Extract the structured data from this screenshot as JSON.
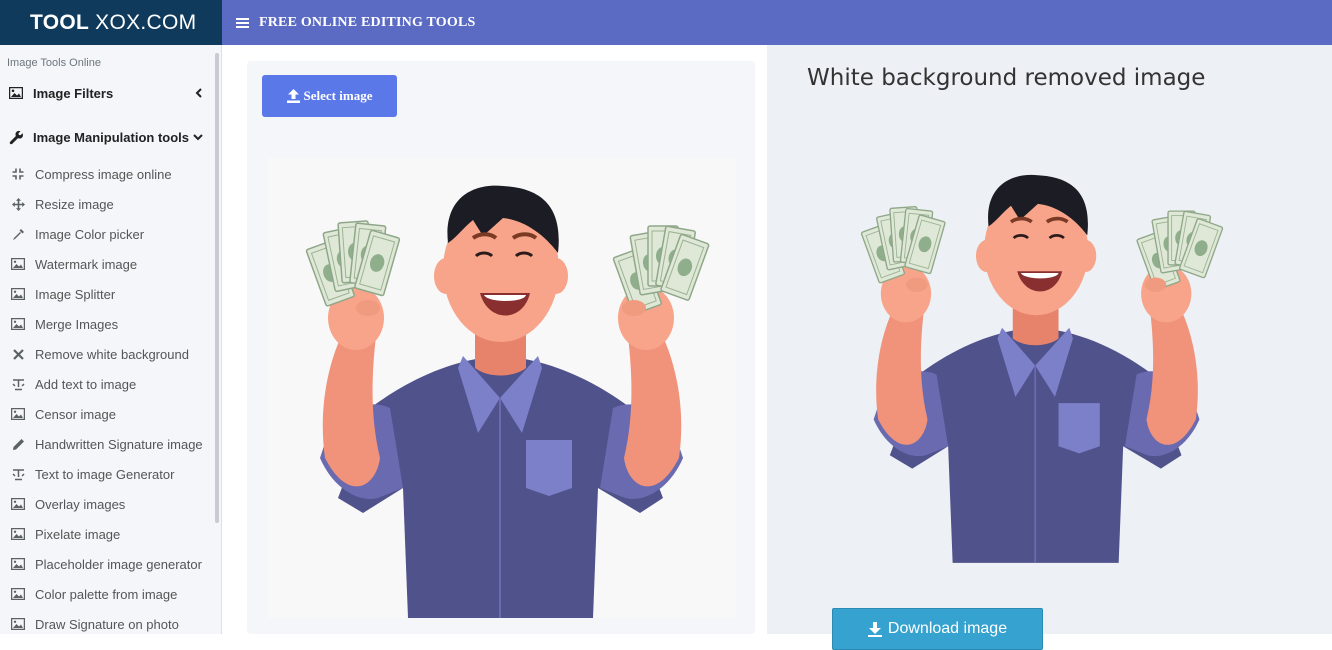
{
  "brand": {
    "bold": "TOOL",
    "rest": "XOX.COM"
  },
  "topbar": {
    "title": "FREE ONLINE EDITING TOOLS",
    "menu_icon": "hamburger-icon"
  },
  "sidebar": {
    "header": "Image Tools Online",
    "sections": [
      {
        "label": "Image Filters",
        "icon": "image-icon",
        "chevron": "chevron-left-icon"
      },
      {
        "label": "Image Manipulation tools",
        "icon": "wrench-icon",
        "chevron": "chevron-down-icon"
      }
    ],
    "items": [
      {
        "label": "Compress image online",
        "icon": "compress-icon"
      },
      {
        "label": "Resize image",
        "icon": "move-icon"
      },
      {
        "label": "Image Color picker",
        "icon": "eyedropper-icon"
      },
      {
        "label": "Watermark image",
        "icon": "image-icon"
      },
      {
        "label": "Image Splitter",
        "icon": "image-icon"
      },
      {
        "label": "Merge Images",
        "icon": "image-icon"
      },
      {
        "label": "Remove white background",
        "icon": "close-icon"
      },
      {
        "label": "Add text to image",
        "icon": "text-icon"
      },
      {
        "label": "Censor image",
        "icon": "image-icon"
      },
      {
        "label": "Handwritten Signature image",
        "icon": "pencil-icon"
      },
      {
        "label": "Text to image Generator",
        "icon": "text-icon"
      },
      {
        "label": "Overlay images",
        "icon": "image-icon"
      },
      {
        "label": "Pixelate image",
        "icon": "image-icon"
      },
      {
        "label": "Placeholder image generator",
        "icon": "image-icon"
      },
      {
        "label": "Color palette from image",
        "icon": "image-icon"
      },
      {
        "label": "Draw Signature on photo",
        "icon": "image-icon"
      }
    ]
  },
  "upload": {
    "select_label": "Select image"
  },
  "result": {
    "title": "White background removed image",
    "download_label": "Download image"
  },
  "colors": {
    "brand_bg": "#0f3a5c",
    "topbar_bg": "#5b6ac3",
    "select_btn": "#5b78e8",
    "download_btn": "#36a2cf"
  }
}
